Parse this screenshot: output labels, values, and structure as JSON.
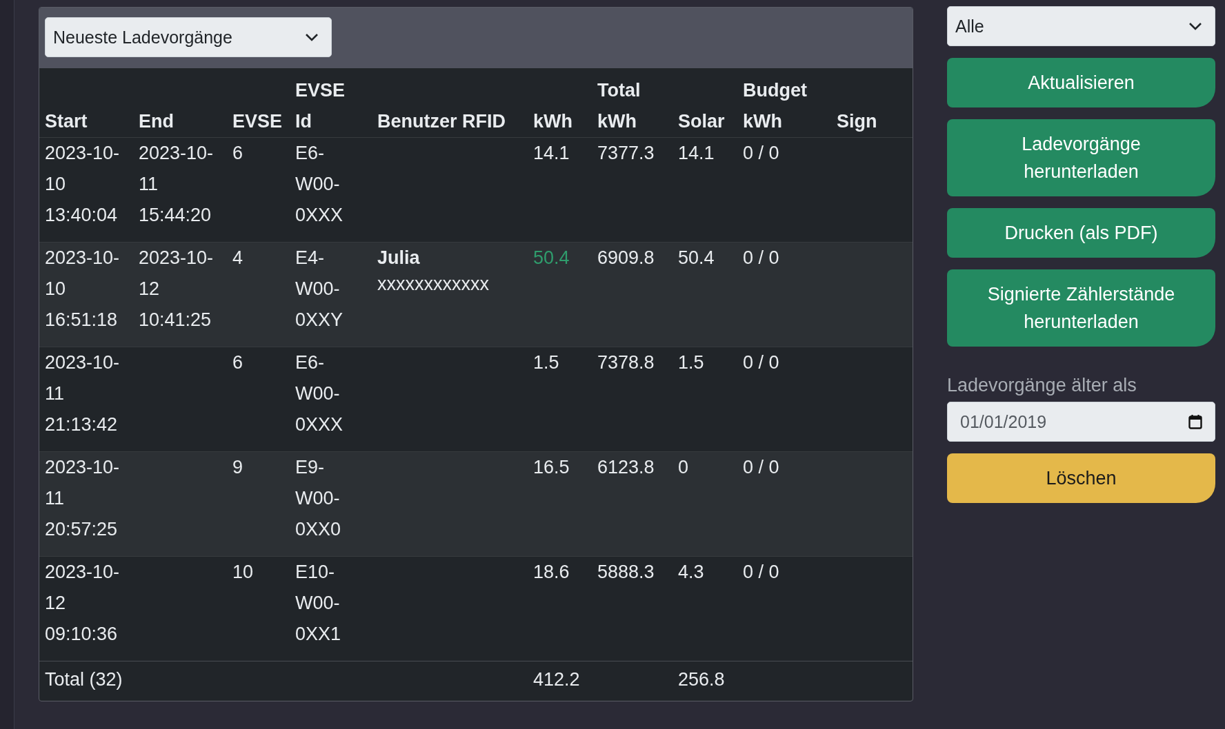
{
  "sessions_panel": {
    "view_select": {
      "value": "Neueste Ladevorgänge"
    },
    "table": {
      "columns": [
        "Start",
        "End",
        "EVSE",
        "EVSE Id",
        "Benutzer RFID",
        "kWh",
        "Total kWh",
        "Solar",
        "Budget kWh",
        "Sign"
      ],
      "rows": [
        {
          "start": "2023-10-10 13:40:04",
          "end": "2023-10-11 15:44:20",
          "evse": "6",
          "evse_id": "E6-W00-0XXX",
          "user_name": "",
          "rfid": "",
          "kwh": "14.1",
          "kwh_highlight": false,
          "total_kwh": "7377.3",
          "solar": "14.1",
          "budget_kwh": "0 / 0"
        },
        {
          "start": "2023-10-10 16:51:18",
          "end": "2023-10-12 10:41:25",
          "evse": "4",
          "evse_id": "E4-W00-0XXY",
          "user_name": "Julia",
          "rfid": "xxxxxxxxxxxx",
          "kwh": "50.4",
          "kwh_highlight": true,
          "total_kwh": "6909.8",
          "solar": "50.4",
          "budget_kwh": "0 / 0"
        },
        {
          "start": "2023-10-11 21:13:42",
          "end": "",
          "evse": "6",
          "evse_id": "E6-W00-0XXX",
          "user_name": "",
          "rfid": "",
          "kwh": "1.5",
          "kwh_highlight": false,
          "total_kwh": "7378.8",
          "solar": "1.5",
          "budget_kwh": "0 / 0"
        },
        {
          "start": "2023-10-11 20:57:25",
          "end": "",
          "evse": "9",
          "evse_id": "E9-W00-0XX0",
          "user_name": "",
          "rfid": "",
          "kwh": "16.5",
          "kwh_highlight": false,
          "total_kwh": "6123.8",
          "solar": "0",
          "budget_kwh": "0 / 0"
        },
        {
          "start": "2023-10-12 09:10:36",
          "end": "",
          "evse": "10",
          "evse_id": "E10-W00-0XX1",
          "user_name": "",
          "rfid": "",
          "kwh": "18.6",
          "kwh_highlight": false,
          "total_kwh": "5888.3",
          "solar": "4.3",
          "budget_kwh": "0 / 0"
        }
      ],
      "footer": {
        "label": "Total (32)",
        "kwh": "412.2",
        "solar": "256.8"
      }
    }
  },
  "sidebar": {
    "filter_select": {
      "value": "Alle"
    },
    "buttons": [
      {
        "label": "Aktualisieren",
        "kind": "primary"
      },
      {
        "label": "Ladevorgänge herunterladen",
        "kind": "primary"
      },
      {
        "label": "Drucken (als PDF)",
        "kind": "primary"
      },
      {
        "label": "Signierte Zählerstände herunterladen",
        "kind": "primary"
      }
    ],
    "delete_section": {
      "label": "Ladevorgänge älter als",
      "date": {
        "value": "01/01/2019"
      },
      "button": {
        "label": "Löschen",
        "kind": "warning"
      }
    }
  }
}
